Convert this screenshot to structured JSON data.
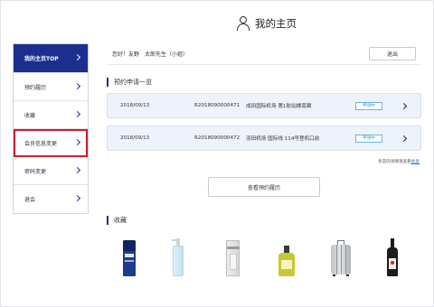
{
  "page": {
    "title": "我的主页",
    "title_icon": "person-icon"
  },
  "sidebar": {
    "items": [
      {
        "label": "我的主页TOP",
        "state": "active"
      },
      {
        "label": "预约履历",
        "state": "normal"
      },
      {
        "label": "收藏",
        "state": "normal"
      },
      {
        "label": "会员信息变更",
        "state": "highlighted"
      },
      {
        "label": "密码变更",
        "state": "normal"
      },
      {
        "label": "退会",
        "state": "normal"
      }
    ]
  },
  "greeting": {
    "text": "您好！友野　太郎先生（小姐）",
    "logout_label": "退出"
  },
  "reservations": {
    "heading": "预约申请一览",
    "items": [
      {
        "date": "2018/09/13",
        "number": "R2018090000471",
        "place": "成田国际机场 第1航站楼南翼",
        "status": "申请中"
      },
      {
        "date": "2018/09/13",
        "number": "R2018090000472",
        "place": "羽田机场 国际线 114号登机口前",
        "status": "申请中"
      }
    ],
    "note_prefix": "状态的详情请查看",
    "note_link": "此处",
    "history_button": "查看预约履历"
  },
  "favorites": {
    "heading": "收藏",
    "products": [
      "lab-series-bottle",
      "pump-bottle",
      "boxed-cosmetic",
      "oil-bottle",
      "suitcase",
      "sake-bottle"
    ]
  },
  "colors": {
    "accent": "#1c2f8f",
    "highlight": "#d11c2a",
    "status": "#3a9ad8",
    "card_bg": "#eef2fa"
  }
}
